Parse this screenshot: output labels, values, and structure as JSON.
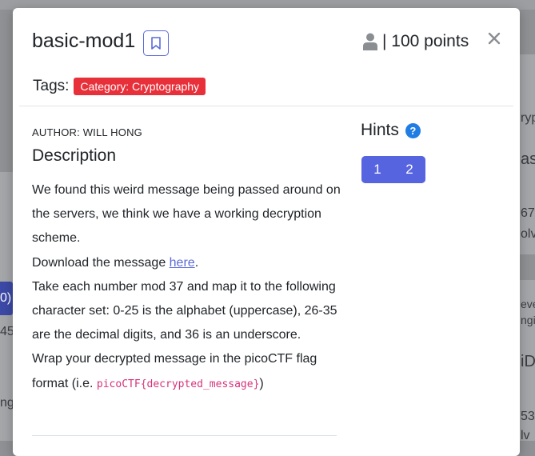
{
  "challenge": {
    "title": "basic-mod1",
    "points": "| 100 points",
    "tags_label": "Tags:",
    "category_badge": "Category: Cryptography",
    "author": "AUTHOR: WILL HONG",
    "description_heading": "Description",
    "description": {
      "p1": "We found this weird message being passed around on the servers, we think we have a working decryption scheme.",
      "p2_prefix": "Download the message ",
      "p2_link": "here",
      "p2_suffix": ".",
      "p3": "Take each number mod 37 and map it to the following character set: 0-25 is the alphabet (uppercase), 26-35 are the decimal digits, and 36 is an underscore.",
      "p4_prefix": "Wrap your decrypted message in the picoCTF flag format (i.e. ",
      "p4_code": "picoCTF{decrypted_message}",
      "p4_suffix": ")"
    },
    "hints_heading": "Hints",
    "hints": [
      "1",
      "2"
    ]
  },
  "icons": {
    "bookmark": "bookmark-icon",
    "user": "user-icon",
    "close": "close-icon",
    "help": "question-circle-icon"
  },
  "background_fragments": [
    "ryp",
    "as",
    "67",
    "olv",
    "0)",
    "45",
    "eve",
    "ngi",
    "iD",
    "ng",
    "53",
    "lv"
  ],
  "colors": {
    "accent": "#5664e0",
    "category_badge": "#e8303a",
    "help_icon": "#1f7de3",
    "code_text": "#d6337c"
  }
}
